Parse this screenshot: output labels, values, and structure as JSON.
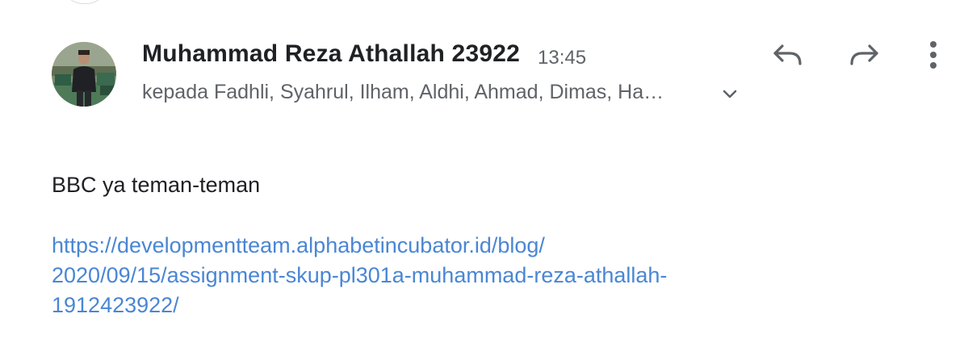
{
  "email": {
    "sender_name": "Muhammad Reza Athallah 23922",
    "time": "13:45",
    "recipients": "kepada Fadhli, Syahrul, Ilham, Aldhi, Ahmad, Dimas, Ha…",
    "body": "BBC ya teman-teman",
    "link_lines": [
      "https://developmentteam.alphabetincubator.id/blog/",
      "2020/09/15/assignment-skup-pl301a-muhammad-reza-athallah-",
      "1912423922/"
    ]
  },
  "actions": {
    "reply_icon": "reply-icon",
    "forward_icon": "forward-icon",
    "more_icon": "more-vert-icon",
    "expand_icon": "chevron-down-icon"
  },
  "colors": {
    "text_primary": "#202124",
    "text_secondary": "#5f6368",
    "link": "#4a86d4",
    "icon": "#5f6368"
  }
}
